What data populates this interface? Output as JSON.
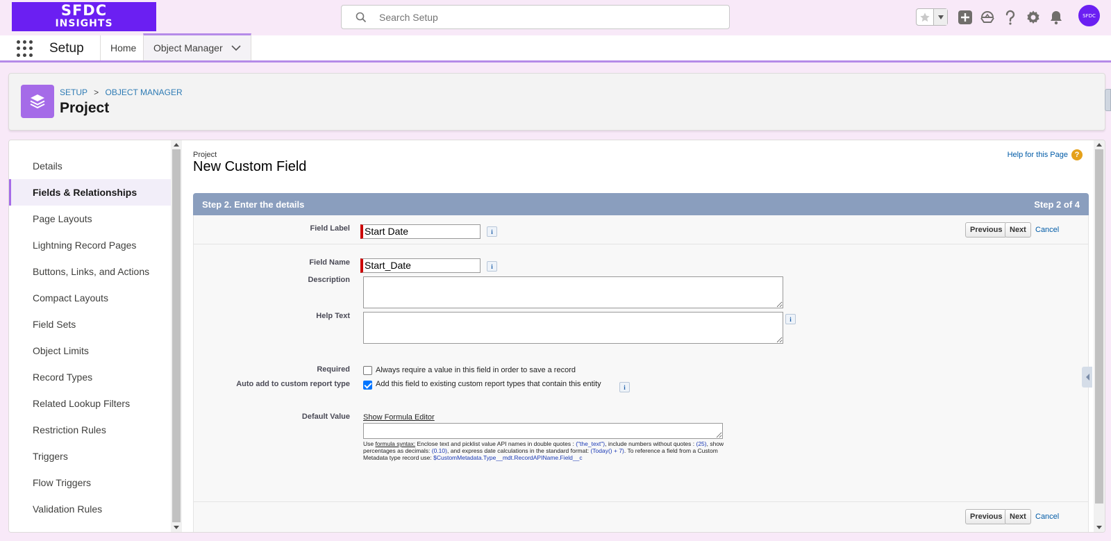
{
  "header": {
    "logo_line1": "SFDC",
    "logo_line2": "INSIGHTS",
    "search_placeholder": "Search Setup",
    "avatar_text": "SFDC"
  },
  "context_bar": {
    "app_name": "Setup",
    "tabs": [
      {
        "label": "Home"
      },
      {
        "label": "Object Manager"
      }
    ]
  },
  "object_header": {
    "breadcrumb": [
      "SETUP",
      "OBJECT MANAGER"
    ],
    "breadcrumb_sep": ">",
    "title": "Project"
  },
  "sidebar": {
    "items": [
      {
        "label": "Details"
      },
      {
        "label": "Fields & Relationships",
        "active": true
      },
      {
        "label": "Page Layouts"
      },
      {
        "label": "Lightning Record Pages"
      },
      {
        "label": "Buttons, Links, and Actions"
      },
      {
        "label": "Compact Layouts"
      },
      {
        "label": "Field Sets"
      },
      {
        "label": "Object Limits"
      },
      {
        "label": "Record Types"
      },
      {
        "label": "Related Lookup Filters"
      },
      {
        "label": "Restriction Rules"
      },
      {
        "label": "Triggers"
      },
      {
        "label": "Flow Triggers"
      },
      {
        "label": "Validation Rules"
      }
    ]
  },
  "page": {
    "object_name": "Project",
    "heading": "New Custom Field",
    "help_link": "Help for this Page",
    "step_title": "Step 2. Enter the details",
    "step_count": "Step 2 of 4",
    "buttons": {
      "previous": "Previous",
      "next": "Next",
      "cancel": "Cancel"
    }
  },
  "form": {
    "field_label": {
      "label": "Field Label",
      "value": "Start Date"
    },
    "field_name": {
      "label": "Field Name",
      "value": "Start_Date"
    },
    "description": {
      "label": "Description",
      "value": ""
    },
    "help_text": {
      "label": "Help Text",
      "value": ""
    },
    "required": {
      "label": "Required",
      "text": "Always require a value in this field in order to save a record",
      "checked": false
    },
    "auto_add": {
      "label": "Auto add to custom report type",
      "text": "Add this field to existing custom report types that contain this entity",
      "checked": true
    },
    "default_value": {
      "label": "Default Value",
      "formula_link": "Show Formula Editor",
      "hint": {
        "use": "Use ",
        "formula_syntax": "formula syntax:",
        "t1": " Enclose text and picklist value API names in double quotes : ",
        "ex1": "(\"the_text\")",
        "t2": ", include numbers without quotes : ",
        "ex2": "(25)",
        "t3": ", show percentages as decimals: ",
        "ex3": "(0.10)",
        "t4": ", and express date calculations in the standard format: ",
        "ex4": "(Today() + 7)",
        "t5": ". To reference a field from a Custom Metadata type record use: ",
        "ex5": "$CustomMetadata.Type__mdt.RecordAPIName.Field__c"
      }
    }
  },
  "colors": {
    "brand_purple": "#6b1ff2",
    "object_icon": "#a56be8",
    "step_bar": "#8a9ebe",
    "required_marker": "#cc0000",
    "link_blue": "#015ba7"
  }
}
